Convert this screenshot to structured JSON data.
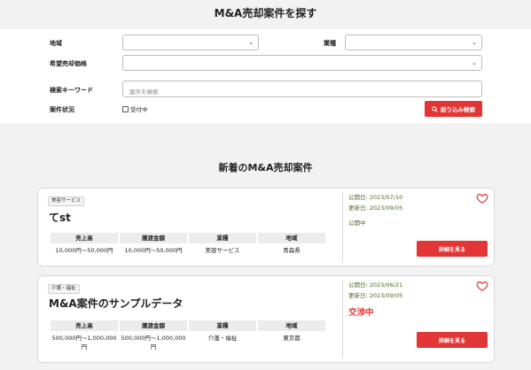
{
  "page": {
    "title": "M&A売却案件を探す"
  },
  "search": {
    "region_label": "地域",
    "industry_label": "業種",
    "price_label": "希望売却価格",
    "keyword_label": "検索キーワード",
    "keyword_placeholder": "案件を検索",
    "status_label": "案件状況",
    "accepting_label": "受付中",
    "button_label": "絞り込み検索"
  },
  "listing": {
    "title": "新着のM&A売却案件"
  },
  "table_headers": [
    "売上高",
    "譲渡金額",
    "業種",
    "地域"
  ],
  "cards": [
    {
      "tag": "美容サービス",
      "title": "てst",
      "values": [
        "10,000円〜50,000円",
        "10,000円〜50,000円",
        "美容サービス",
        "青森県"
      ],
      "published": "公開日: 2023/07/10",
      "updated": "更新日: 2023/09/05",
      "status": "公開中",
      "detail_label": "詳細を見る"
    },
    {
      "tag": "介護・福祉",
      "title": "M&A案件のサンプルデータ",
      "values": [
        "500,000円〜1,000,000円",
        "500,000円〜1,000,000円",
        "介護・福祉",
        "東京都"
      ],
      "published": "公開日: 2023/06/21",
      "updated": "更新日: 2023/09/05",
      "status": "交渉中",
      "detail_label": "詳細を見る"
    }
  ],
  "colors": {
    "accent": "#e23535",
    "date_text": "#4a6a1f",
    "page_bg": "#f2f2f2"
  }
}
